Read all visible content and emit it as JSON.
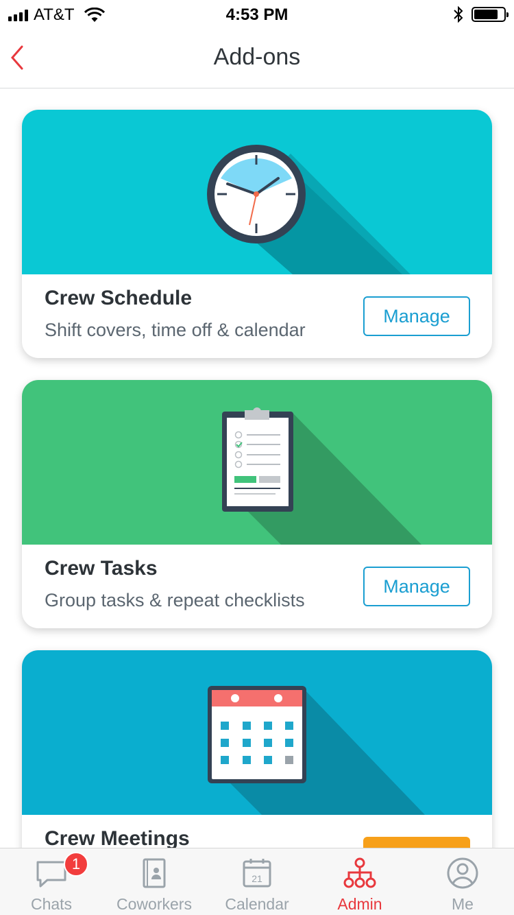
{
  "status_bar": {
    "carrier": "AT&T",
    "time": "4:53 PM",
    "icons": [
      "signal-icon",
      "wifi-icon",
      "bluetooth-icon",
      "battery-icon"
    ]
  },
  "nav": {
    "title": "Add-ons",
    "back_icon": "chevron-left-icon"
  },
  "cards": [
    {
      "title": "Crew Schedule",
      "subtitle": "Shift covers, time off & calendar",
      "button": "Manage",
      "banner_color": "#0ac8d4",
      "illustration": "clock-icon"
    },
    {
      "title": "Crew Tasks",
      "subtitle": "Group tasks & repeat checklists",
      "button": "Manage",
      "banner_color": "#41c37b",
      "illustration": "clipboard-icon"
    },
    {
      "title": "Crew Meetings",
      "subtitle": "",
      "button": "",
      "banner_color": "#0aaecf",
      "illustration": "calendar-icon",
      "button_color": "#f7a01a"
    }
  ],
  "tabs": [
    {
      "label": "Chats",
      "icon": "chat-bubble-icon",
      "badge": "1",
      "active": false
    },
    {
      "label": "Coworkers",
      "icon": "contacts-icon",
      "active": false
    },
    {
      "label": "Calendar",
      "icon": "calendar-icon",
      "calendar_day": "21",
      "active": false
    },
    {
      "label": "Admin",
      "icon": "org-chart-icon",
      "active": true
    },
    {
      "label": "Me",
      "icon": "user-icon",
      "active": false
    }
  ],
  "colors": {
    "accent_red": "#e8383d",
    "accent_blue": "#1a9ed1",
    "badge_red": "#f23d3d"
  }
}
